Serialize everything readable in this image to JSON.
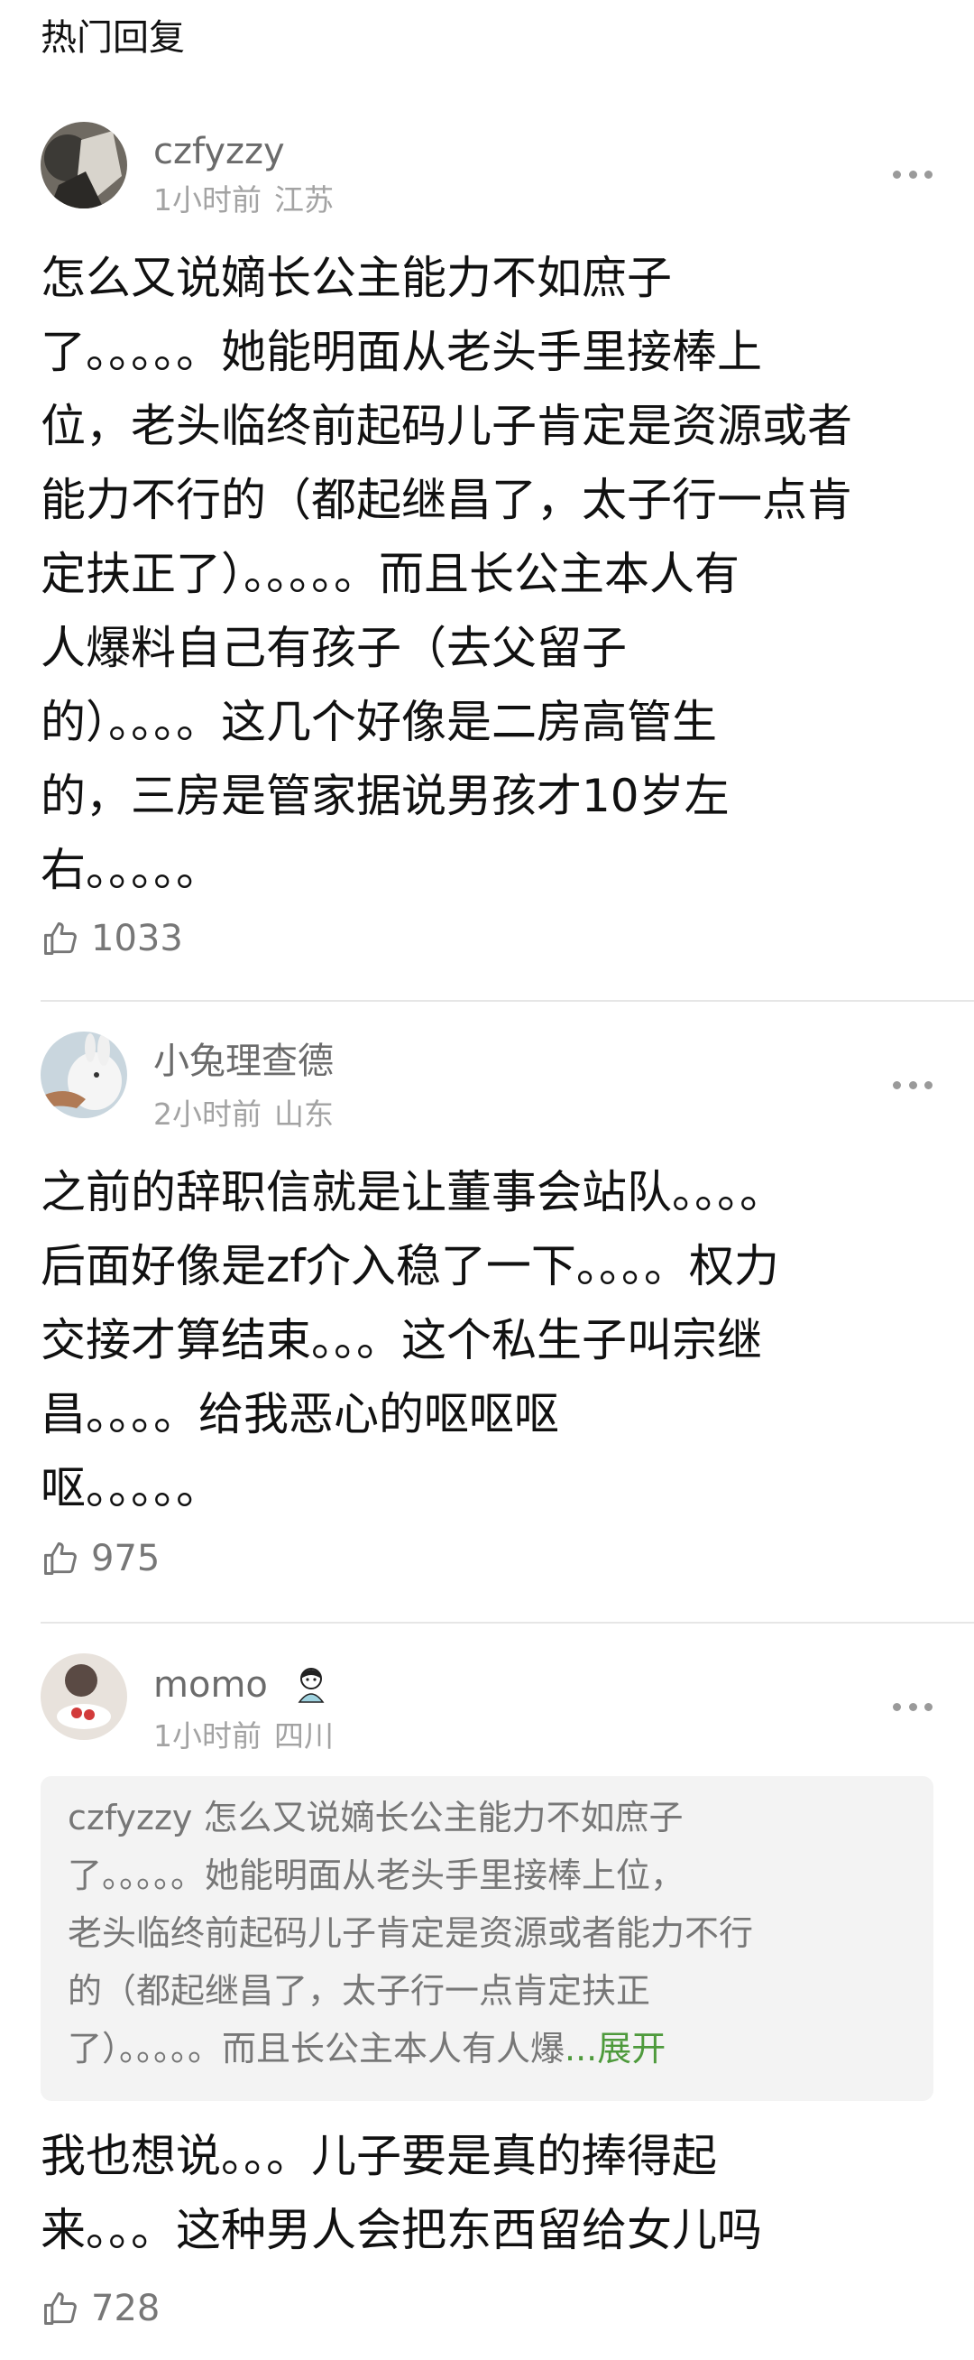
{
  "section_title": "热门回复",
  "comments": [
    {
      "username": "czfyzzy",
      "time": "1小时前",
      "location": "江苏",
      "lines": [
        "怎么又说嫡长公主能力不如庶子",
        "了。。。。。她能明面从老头手里接棒上",
        "位，老头临终前起码儿子肯定是资源或者",
        "能力不行的（都起继昌了，太子行一点肯",
        "定扶正了）。。。。。而且长公主本人有",
        "人爆料自己有孩子（去父留子",
        "的）。。。。这几个好像是二房高管生",
        "的，三房是管家据说男孩才10岁左",
        "右。。。。。"
      ],
      "likes": "1033"
    },
    {
      "username": "小兔理查德",
      "time": "2小时前",
      "location": "山东",
      "lines": [
        "之前的辞职信就是让董事会站队。。。。",
        "后面好像是zf介入稳了一下。。。。权力",
        "交接才算结束。。。这个私生子叫宗继",
        "昌。。。。给我恶心的呕呕呕",
        "呕。。。。。"
      ],
      "likes": "975"
    },
    {
      "username": "momo",
      "time": "1小时前",
      "location": "四川",
      "quote": {
        "author": "czfyzzy",
        "lines": [
          " 怎么又说嫡长公主能力不如庶子",
          "了。。。。。她能明面从老头手里接棒上位，",
          "老头临终前起码儿子肯定是资源或者能力不行",
          "的（都起继昌了，太子行一点肯定扶正",
          "了）。。。。。而且长公主本人有人爆"
        ],
        "expand_label": "...展开"
      },
      "lines": [
        "我也想说。。。儿子要是真的捧得起",
        "来。。。这种男人会把东西留给女儿吗"
      ],
      "likes": "728"
    }
  ],
  "icons": {
    "more": "more-dots-icon",
    "like": "thumbs-up-icon",
    "badge": "avatar-badge-icon"
  }
}
